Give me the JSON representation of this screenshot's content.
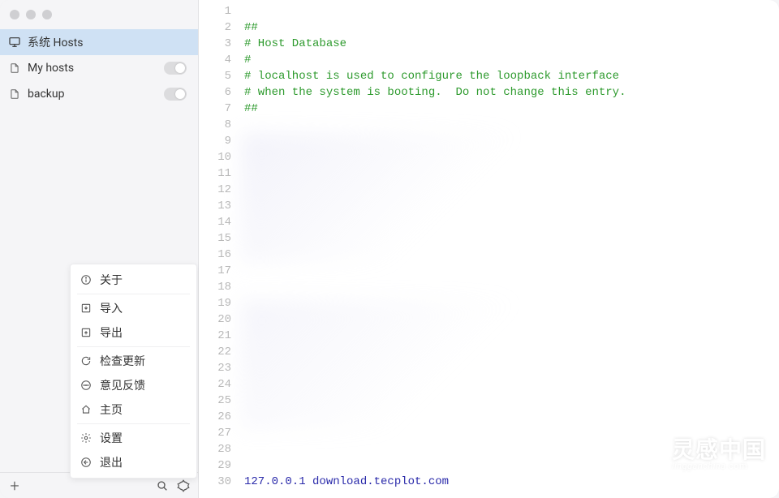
{
  "sidebar": {
    "items": [
      {
        "label": "系统 Hosts",
        "icon": "monitor",
        "active": true,
        "toggle": false
      },
      {
        "label": "My hosts",
        "icon": "file",
        "active": false,
        "toggle": true
      },
      {
        "label": "backup",
        "icon": "file",
        "active": false,
        "toggle": true
      }
    ]
  },
  "menu": {
    "items": [
      {
        "label": "关于",
        "icon": "info"
      },
      {
        "label": "导入",
        "icon": "import",
        "sep_before": true
      },
      {
        "label": "导出",
        "icon": "export"
      },
      {
        "label": "检查更新",
        "icon": "refresh",
        "sep_before": true
      },
      {
        "label": "意见反馈",
        "icon": "chat"
      },
      {
        "label": "主页",
        "icon": "home"
      },
      {
        "label": "设置",
        "icon": "gear",
        "sep_before": true
      },
      {
        "label": "退出",
        "icon": "logout"
      }
    ]
  },
  "editor": {
    "lines": [
      {
        "n": 1,
        "text": "",
        "cls": ""
      },
      {
        "n": 2,
        "text": "##",
        "cls": "comment"
      },
      {
        "n": 3,
        "text": "# Host Database",
        "cls": "comment"
      },
      {
        "n": 4,
        "text": "#",
        "cls": "comment"
      },
      {
        "n": 5,
        "text": "# localhost is used to configure the loopback interface",
        "cls": "comment"
      },
      {
        "n": 6,
        "text": "# when the system is booting.  Do not change this entry.",
        "cls": "comment"
      },
      {
        "n": 7,
        "text": "##",
        "cls": "comment"
      },
      {
        "n": 8,
        "text": "",
        "cls": ""
      },
      {
        "n": 9,
        "text": "",
        "cls": ""
      },
      {
        "n": 10,
        "text": "",
        "cls": ""
      },
      {
        "n": 11,
        "text": "",
        "cls": ""
      },
      {
        "n": 12,
        "text": "",
        "cls": ""
      },
      {
        "n": 13,
        "text": "",
        "cls": ""
      },
      {
        "n": 14,
        "text": "",
        "cls": ""
      },
      {
        "n": 15,
        "text": "",
        "cls": ""
      },
      {
        "n": 16,
        "text": "",
        "cls": ""
      },
      {
        "n": 17,
        "text": "",
        "cls": ""
      },
      {
        "n": 18,
        "text": "",
        "cls": ""
      },
      {
        "n": 19,
        "text": "",
        "cls": ""
      },
      {
        "n": 20,
        "text": "",
        "cls": ""
      },
      {
        "n": 21,
        "text": "",
        "cls": ""
      },
      {
        "n": 22,
        "text": "",
        "cls": ""
      },
      {
        "n": 23,
        "text": "",
        "cls": ""
      },
      {
        "n": 24,
        "text": "",
        "cls": ""
      },
      {
        "n": 25,
        "text": "",
        "cls": ""
      },
      {
        "n": 26,
        "text": "",
        "cls": ""
      },
      {
        "n": 27,
        "text": "",
        "cls": ""
      },
      {
        "n": 28,
        "text": "",
        "cls": ""
      },
      {
        "n": 29,
        "text": "",
        "cls": ""
      },
      {
        "n": 30,
        "text": "127.0.0.1 download.tecplot.com",
        "cls": "hostline"
      }
    ]
  },
  "watermark": {
    "big": "灵感中国",
    "small": "lingganchina",
    "suffix": ".com"
  }
}
